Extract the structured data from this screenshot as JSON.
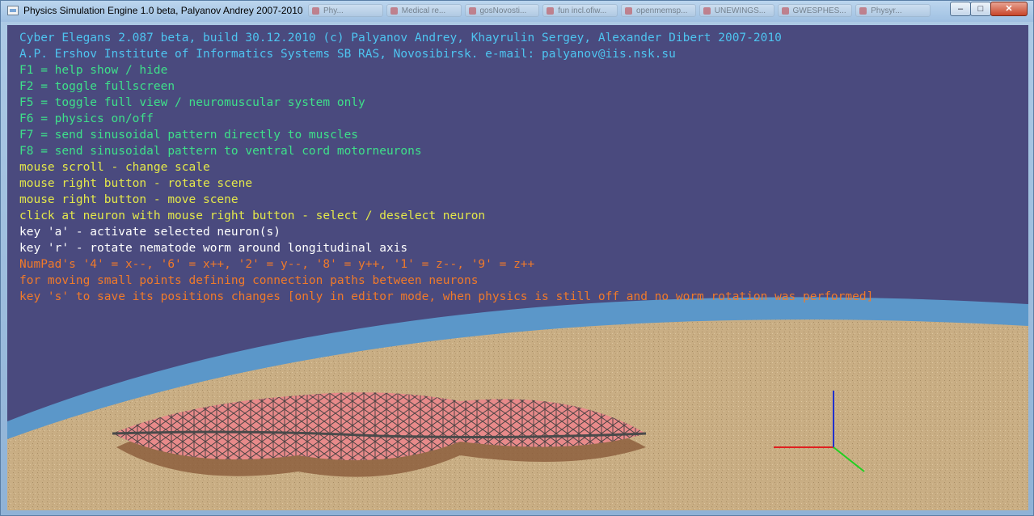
{
  "window": {
    "title": "Physics Simulation Engine 1.0 beta, Palyanov Andrey 2007-2010",
    "controls": {
      "minimize": "–",
      "maximize": "□",
      "close": "✕"
    },
    "icon": "app-window-icon"
  },
  "taskbar_ghost_tabs": [
    "Phy...",
    "Medical re...",
    "gosNovosti...",
    "fun incl.ofiw...",
    "openmemsp...",
    "UNEWINGS...",
    "GWESPHES...",
    "Physyr..."
  ],
  "help": {
    "lines": [
      {
        "text": "Cyber Elegans 2.087 beta, build 30.12.2010 (c) Palyanov Andrey, Khayrulin Sergey, Alexander Dibert 2007-2010",
        "color": "cyan"
      },
      {
        "text": "A.P. Ershov Institute of Informatics Systems SB RAS, Novosibirsk. e-mail: palyanov@iis.nsk.su",
        "color": "cyan"
      },
      {
        "text": "F1 = help show / hide",
        "color": "green"
      },
      {
        "text": "F2 = toggle fullscreen",
        "color": "green"
      },
      {
        "text": "F5 = toggle full view / neuromuscular system only",
        "color": "green"
      },
      {
        "text": "F6 = physics on/off",
        "color": "green"
      },
      {
        "text": "F7 = send sinusoidal pattern directly to muscles",
        "color": "green"
      },
      {
        "text": "F8 = send sinusoidal pattern to ventral cord motorneurons",
        "color": "green"
      },
      {
        "text": "mouse scroll - change scale",
        "color": "yellow"
      },
      {
        "text": "mouse right button - rotate scene",
        "color": "yellow"
      },
      {
        "text": "mouse right button - move scene",
        "color": "yellow"
      },
      {
        "text": "click at neuron with mouse right button - select / deselect neuron",
        "color": "yellow"
      },
      {
        "text": "key 'a' - activate selected neuron(s)",
        "color": "white"
      },
      {
        "text": "key 'r' - rotate nematode worm around longitudinal axis",
        "color": "white"
      },
      {
        "text": "NumPad's '4' = x--, '6' = x++, '2' = y--, '8' = y++, '1' = z--, '9' = z++",
        "color": "orange"
      },
      {
        "text": "for moving small points defining connection paths between neurons",
        "color": "orange"
      },
      {
        "text": "key 's' to save its positions changes [only in editor mode, when physics is still off and no worm rotation was performed]",
        "color": "orange"
      }
    ]
  },
  "scene": {
    "background_color": "#4a4a7e",
    "water_color": "#5b97c9",
    "ground_color": "#c8ad82",
    "worm_membrane_color": "#e88a8a",
    "worm_mesh_color": "#555555",
    "axes": {
      "x_color": "#e02020",
      "y_color": "#2030d0",
      "z_color": "#20d020"
    }
  }
}
